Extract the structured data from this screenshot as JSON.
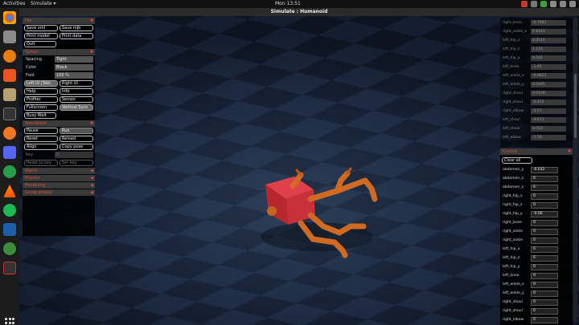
{
  "topbar": {
    "activities": "Activities",
    "app_menu": "Simulate ▾",
    "clock": "Mon 13:51"
  },
  "window": {
    "title": "Simulate : Humanoid"
  },
  "dock": {
    "icons": [
      "chrome-icon",
      "files-icon",
      "blender-icon",
      "ubuntu-software-icon",
      "gimp-icon",
      "terminal-icon",
      "jupyter-icon",
      "discord-icon",
      "browser-icon",
      "vlc-icon",
      "spotify-icon",
      "virtualbox-icon",
      "fdm-icon",
      "screen-recorder-icon",
      "app-grid-icon"
    ]
  },
  "left_panel": {
    "file": {
      "title": "File",
      "buttons": [
        "Save xml",
        "Save mjb",
        "Print model",
        "Print data",
        "Quit"
      ]
    },
    "option": {
      "title": "Option",
      "spacing_label": "Spacing",
      "spacing_value": "Tight",
      "color_label": "Color",
      "color_value": "Black",
      "font_label": "Font",
      "font_value": "100 %",
      "buttons": [
        "Left UI (Tab)",
        "Right UI",
        "Help",
        "Info",
        "Profiler",
        "Sensor",
        "Fullscreen",
        "Vertical Sync",
        "Busy Wait"
      ]
    },
    "simulation": {
      "title": "Simulation",
      "buttons": [
        "Pause",
        "Run",
        "Reset",
        "Reload",
        "Align",
        "Copy pose"
      ],
      "key_label": "Key",
      "key_value": "0",
      "reset_to_key": "Reset to key",
      "set_key": "Set key"
    },
    "collapsed": [
      "Watch",
      "Physics",
      "Rendering",
      "Group enable"
    ]
  },
  "right_panel": {
    "joints": [
      {
        "name": "right_knee",
        "value": "-0.7882"
      },
      {
        "name": "right_ankle_x",
        "value": "0.6241"
      },
      {
        "name": "left_hip_x",
        "value": "0.0519"
      },
      {
        "name": "left_hip_z",
        "value": "1.114"
      },
      {
        "name": "left_hip_y",
        "value": "0.241"
      },
      {
        "name": "left_knee",
        "value": "-1.45"
      },
      {
        "name": "left_ankle_x",
        "value": "-0.0623"
      },
      {
        "name": "left_ankle_y",
        "value": "0.0345"
      },
      {
        "name": "right_shoul",
        "value": "0.0158"
      },
      {
        "name": "right_shoul",
        "value": "-0.451"
      },
      {
        "name": "right_elbow",
        "value": "-1.57"
      },
      {
        "name": "left_shoul",
        "value": "-0.671"
      },
      {
        "name": "left_shoul",
        "value": "0.553"
      },
      {
        "name": "left_elbow",
        "value": "-1.56"
      }
    ],
    "control": {
      "title": "Control",
      "clear_all": "Clear all",
      "rows": [
        {
          "name": "abdomen_y",
          "value": "-0.032"
        },
        {
          "name": "abdomen_z",
          "value": "0"
        },
        {
          "name": "abdomen_x",
          "value": "0"
        },
        {
          "name": "right_hip_x",
          "value": "0"
        },
        {
          "name": "right_hip_z",
          "value": "0"
        },
        {
          "name": "right_hip_y",
          "value": "-0.06"
        },
        {
          "name": "right_knee",
          "value": "0"
        },
        {
          "name": "right_ankle",
          "value": "0"
        },
        {
          "name": "right_ankle",
          "value": "0"
        },
        {
          "name": "left_hip_x",
          "value": "0"
        },
        {
          "name": "left_hip_z",
          "value": "0"
        },
        {
          "name": "left_hip_y",
          "value": "0"
        },
        {
          "name": "left_knee",
          "value": "0"
        },
        {
          "name": "left_ankle_x",
          "value": "0"
        },
        {
          "name": "left_ankle_y",
          "value": "0"
        },
        {
          "name": "right_shoul",
          "value": "0"
        },
        {
          "name": "right_shoul",
          "value": "0"
        },
        {
          "name": "right_elbow",
          "value": "0"
        }
      ]
    }
  },
  "colors": {
    "accent": "#e0503a",
    "body": "#c8641e",
    "torso": "#d0303a",
    "floor_dark": "#111a28",
    "floor_light": "#3f5573"
  }
}
